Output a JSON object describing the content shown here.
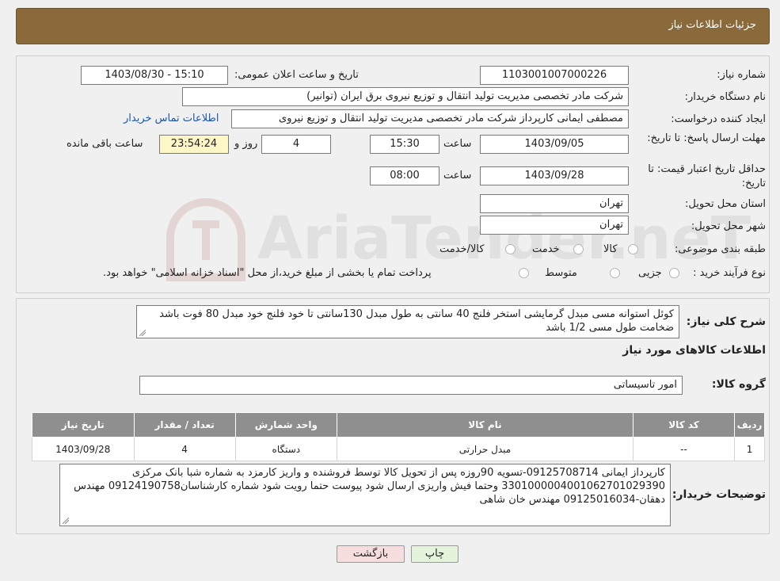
{
  "header": {
    "title": "جزئیات اطلاعات نیاز"
  },
  "info": {
    "need_number_label": "شماره نیاز:",
    "need_number": "1103001007000226",
    "announce_label": "تاریخ و ساعت اعلان عمومی:",
    "announce_value": "1403/08/30 - 15:10",
    "buyer_label": "نام دستگاه خریدار:",
    "buyer_value": "شرکت مادر تخصصی مدیریت تولید  انتقال و توزیع نیروی برق ایران (توانیر)",
    "creator_label": "ایجاد کننده درخواست:",
    "creator_value": "مصطفی ایمانی کارپرداز شرکت مادر تخصصی مدیریت تولید  انتقال و توزیع نیروی",
    "contact_link": "اطلاعات تماس خریدار",
    "deadline_label": "مهلت ارسال پاسخ: تا تاریخ:",
    "deadline_date": "1403/09/05",
    "time_label": "ساعت",
    "deadline_time": "15:30",
    "days_value": "4",
    "days_label": "روز و",
    "remaining_value": "23:54:24",
    "remaining_label": "ساعت باقی مانده",
    "validity_label": "حداقل تاریخ اعتبار قیمت: تا تاریخ:",
    "validity_date": "1403/09/28",
    "validity_time": "08:00",
    "province_label": "استان محل تحویل:",
    "province_value": "تهران",
    "city_label": "شهر محل تحویل:",
    "city_value": "تهران",
    "category_label": "طبقه بندی موضوعی:",
    "category_options": [
      "کالا",
      "خدمت",
      "کالا/خدمت"
    ],
    "process_label": "نوع فرآیند خرید :",
    "process_options": [
      "جزیی",
      "متوسط"
    ],
    "process_note": "پرداخت تمام یا بخشی از مبلغ خرید،از محل \"اسناد خزانه اسلامی\" خواهد بود."
  },
  "description": {
    "label": "شرح کلی نیاز:",
    "text": "کوئل استوانه مسی مبدل گرمایشی استخر فلنج 40 سانتی به طول مبدل 130سانتی تا خود فلنج خود مبدل 80 فوت باشد ضخامت طول مسی 1/2 باشد"
  },
  "goods": {
    "section_title": "اطلاعات کالاهای مورد نیاز",
    "group_label": "گروه کالا:",
    "group_value": "امور تاسیساتی",
    "table": {
      "headers": [
        "ردیف",
        "کد کالا",
        "نام کالا",
        "واحد شمارش",
        "تعداد / مقدار",
        "تاریخ نیاز"
      ],
      "rows": [
        [
          "1",
          "--",
          "مبدل حرارتی",
          "دستگاه",
          "4",
          "1403/09/28"
        ]
      ]
    }
  },
  "buyer_notes": {
    "label": "توضیحات خریدار:",
    "text": "کارپرداز ایمانی 09125708714-تسویه 90روزه پس از تحویل کالا توسط فروشنده و واریز کارمزد به شماره شبا بانک مرکزی 330100000400106270102939‎0 وحتما فیش واریزی ارسال شود پیوست حتما رویت شود شماره کارشناسان09124190758 مهندس دهقان-09125016034 مهندس خان شاهی"
  },
  "buttons": {
    "print": "چاپ",
    "back": "بازگشت"
  },
  "watermark": "AriaTender.neT",
  "colors": {
    "header_bg": "#8a6a3b",
    "table_header": "#8f8f8f",
    "remaining_bg": "#fdf7c8",
    "back_btn": "#f7dede",
    "print_btn": "#e3f3dc"
  }
}
